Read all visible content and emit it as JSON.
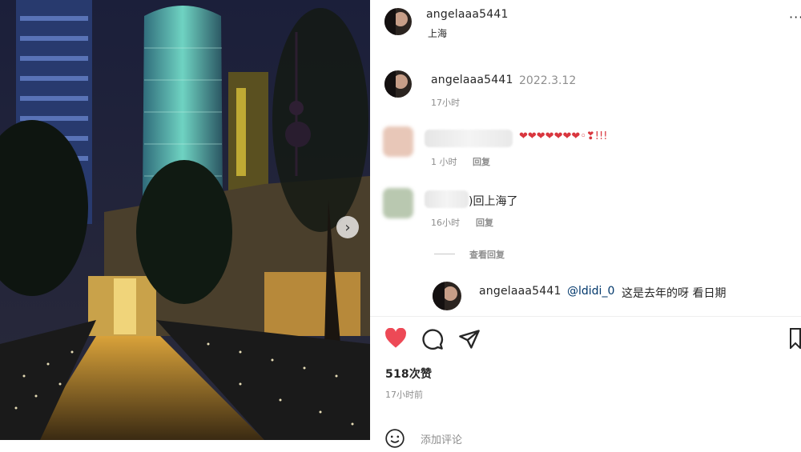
{
  "header": {
    "username": "angelaaa5441",
    "location": "上海"
  },
  "caption": {
    "username": "angelaaa5441",
    "date": "2022.3.12",
    "time": "17小时"
  },
  "comments": [
    {
      "emoji_text": "❤❤❤❤❤❤❤◦❣!!!",
      "time": "1 小时",
      "reply_label": "回复"
    },
    {
      "text": ")回上海了",
      "time": "16小时",
      "reply_label": "回复"
    }
  ],
  "view_replies_label": "查看回复",
  "reply": {
    "username": "angelaaa5441",
    "mention": "@ldidi_0",
    "text": "这是去年的呀 看日期"
  },
  "actions": {
    "likes": "518次赞",
    "time_ago": "17小时前"
  },
  "add_comment": {
    "placeholder": "添加评论"
  },
  "icons": {
    "like": "heart-filled-icon",
    "comment": "comment-bubble-icon",
    "share": "paper-plane-icon",
    "save": "bookmark-icon",
    "more": "more-options-icon",
    "next": "chevron-right-icon",
    "emoji": "smiley-icon"
  },
  "colors": {
    "like": "#ed4956",
    "text": "#262626",
    "meta": "#8e8e8e"
  }
}
